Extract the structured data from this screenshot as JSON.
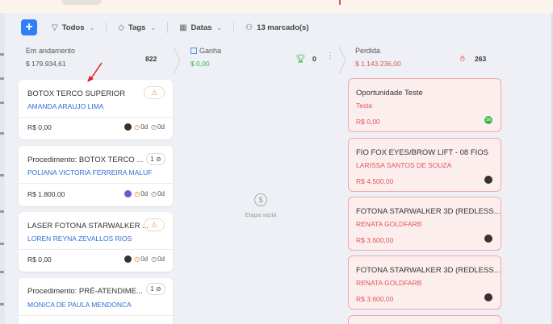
{
  "toolbar": {
    "add": "+",
    "todos": "Todos",
    "tags": "Tags",
    "datas": "Datas",
    "marcados": "13 marcado(s)"
  },
  "columns": {
    "andamento": {
      "title": "Em andamento",
      "value": "$ 179.934,61",
      "count": "822"
    },
    "ganha": {
      "title": "Ganha",
      "value": "$ 0,00",
      "count": "0"
    },
    "perdida": {
      "title": "Perdida",
      "value": "$ 1.143.236,00",
      "count": "263"
    }
  },
  "empty_stage": "Etapa vazia",
  "cards": [
    {
      "title": "BOTOX TERCO SUPERIOR",
      "contact": "AMANDA ARAUJO LIMA",
      "price": "R$ 0,00",
      "d1": "0d",
      "d2": "0d",
      "badge": ""
    },
    {
      "title": "Procedimento: BOTOX TERCO ...",
      "contact": "POLIANA VICTORIA FERREIRA MALUF",
      "price": "R$ 1.800,00",
      "d1": "0d",
      "d2": "0d",
      "badge": "1"
    },
    {
      "title": "LASER FOTONA STARWALKER ...",
      "contact": "LOREN REYNA ZEVALLOS RIOS",
      "price": "R$ 0,00",
      "d1": "0d",
      "d2": "0d",
      "badge": ""
    },
    {
      "title": "Procedimento: PRÉ-ATENDIME...",
      "contact": "MONICA DE PAULA MENDONCA",
      "price": "",
      "d1": "",
      "d2": "",
      "badge": "1"
    }
  ],
  "lost_cards": [
    {
      "title": "Oportunidade Teste",
      "contact": "Teste",
      "price": "R$ 0,00",
      "avatar": "SN"
    },
    {
      "title": "FIO FOX EYES/BROW LIFT - 08 FIOS",
      "contact": "LARISSA SANTOS DE SOUZA",
      "price": "R$ 4.500,00",
      "avatar": ""
    },
    {
      "title": "FOTONA STARWALKER 3D (REDLESS...",
      "contact": "RENATA GOLDFARB",
      "price": "R$ 3.600,00",
      "avatar": ""
    },
    {
      "title": "FOTONA STARWALKER 3D (REDLESS...",
      "contact": "RENATA GOLDFARB",
      "price": "R$ 3.600,00",
      "avatar": ""
    }
  ],
  "colors": {
    "accent": "#2f7ff6",
    "won": "#3bb54a",
    "lost": "#e05555"
  },
  "icons": [
    "plus-icon",
    "filter-icon",
    "tag-icon",
    "calendar-icon",
    "users-icon",
    "trophy-icon",
    "thumbs-down-icon",
    "dollar-icon",
    "clock-icon",
    "warning-icon"
  ]
}
